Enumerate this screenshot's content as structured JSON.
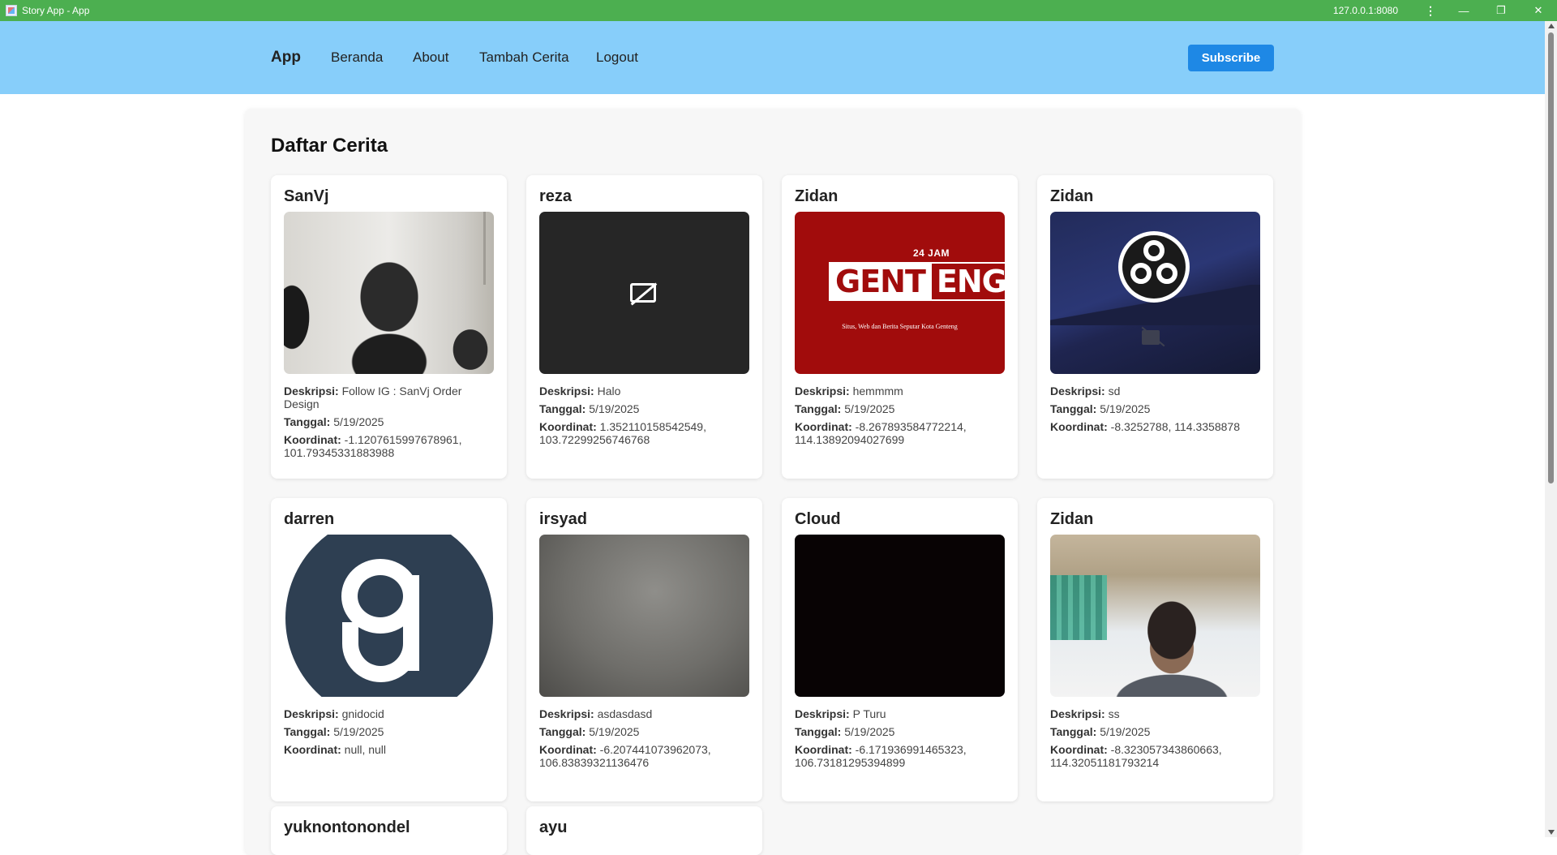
{
  "window": {
    "title": "Story App - App",
    "host": "127.0.0.1:8080",
    "menu_icon": "kebab-menu-icon",
    "minimize_icon": "minimize-icon",
    "maximize_icon": "restore-icon",
    "close_icon": "close-icon"
  },
  "nav": {
    "brand": "App",
    "links": [
      "Beranda",
      "About",
      "Tambah Cerita",
      "Logout"
    ],
    "subscribe_label": "Subscribe"
  },
  "colors": {
    "titlebar": "#4caf50",
    "navbar": "#87cefa",
    "subscribe": "#1e88e5"
  },
  "page": {
    "title": "Daftar Cerita"
  },
  "labels": {
    "description": "Deskripsi:",
    "date": "Tanggal:",
    "coordinates": "Koordinat:"
  },
  "stories": [
    {
      "name": "SanVj",
      "image": "photo-person-classroom",
      "description": "Follow IG : SanVj Order Design",
      "date": "5/19/2025",
      "coordinates": "-1.1207615997678961, 101.79345331883988"
    },
    {
      "name": "reza",
      "image": "camera-off-icon",
      "description": "Halo",
      "date": "5/19/2025",
      "coordinates": "1.352110158542549, 103.72299256746768"
    },
    {
      "name": "Zidan",
      "image": "genteng-24-jam-logo",
      "description": "hemmmm",
      "date": "5/19/2025",
      "coordinates": "-8.267893584772214, 114.13892094027699"
    },
    {
      "name": "Zidan",
      "image": "obs-logo",
      "description": "sd",
      "date": "5/19/2025",
      "coordinates": "-8.3252788, 114.3358878"
    },
    {
      "name": "darren",
      "image": "g-logo",
      "description": "gnidocid",
      "date": "5/19/2025",
      "coordinates": "null, null"
    },
    {
      "name": "irsyad",
      "image": "grey-photo",
      "description": "asdasdasd",
      "date": "5/19/2025",
      "coordinates": "-6.207441073962073, 106.83839321136476"
    },
    {
      "name": "Cloud",
      "image": "black-photo",
      "description": "P Turu",
      "date": "5/19/2025",
      "coordinates": "-6.171936991465323, 106.73181295394899"
    },
    {
      "name": "Zidan",
      "image": "photo-person-selfie",
      "description": "ss",
      "date": "5/19/2025",
      "coordinates": "-8.323057343860663, 114.32051181793214"
    }
  ],
  "more_stories": [
    {
      "name": "yuknontonondel"
    },
    {
      "name": "ayu"
    }
  ],
  "genteng_logo": {
    "top": "24 JAM",
    "left": "GENT",
    "right": "ENG",
    "tagline": "Situs, Web dan Berita Seputar Kota Genteng"
  }
}
